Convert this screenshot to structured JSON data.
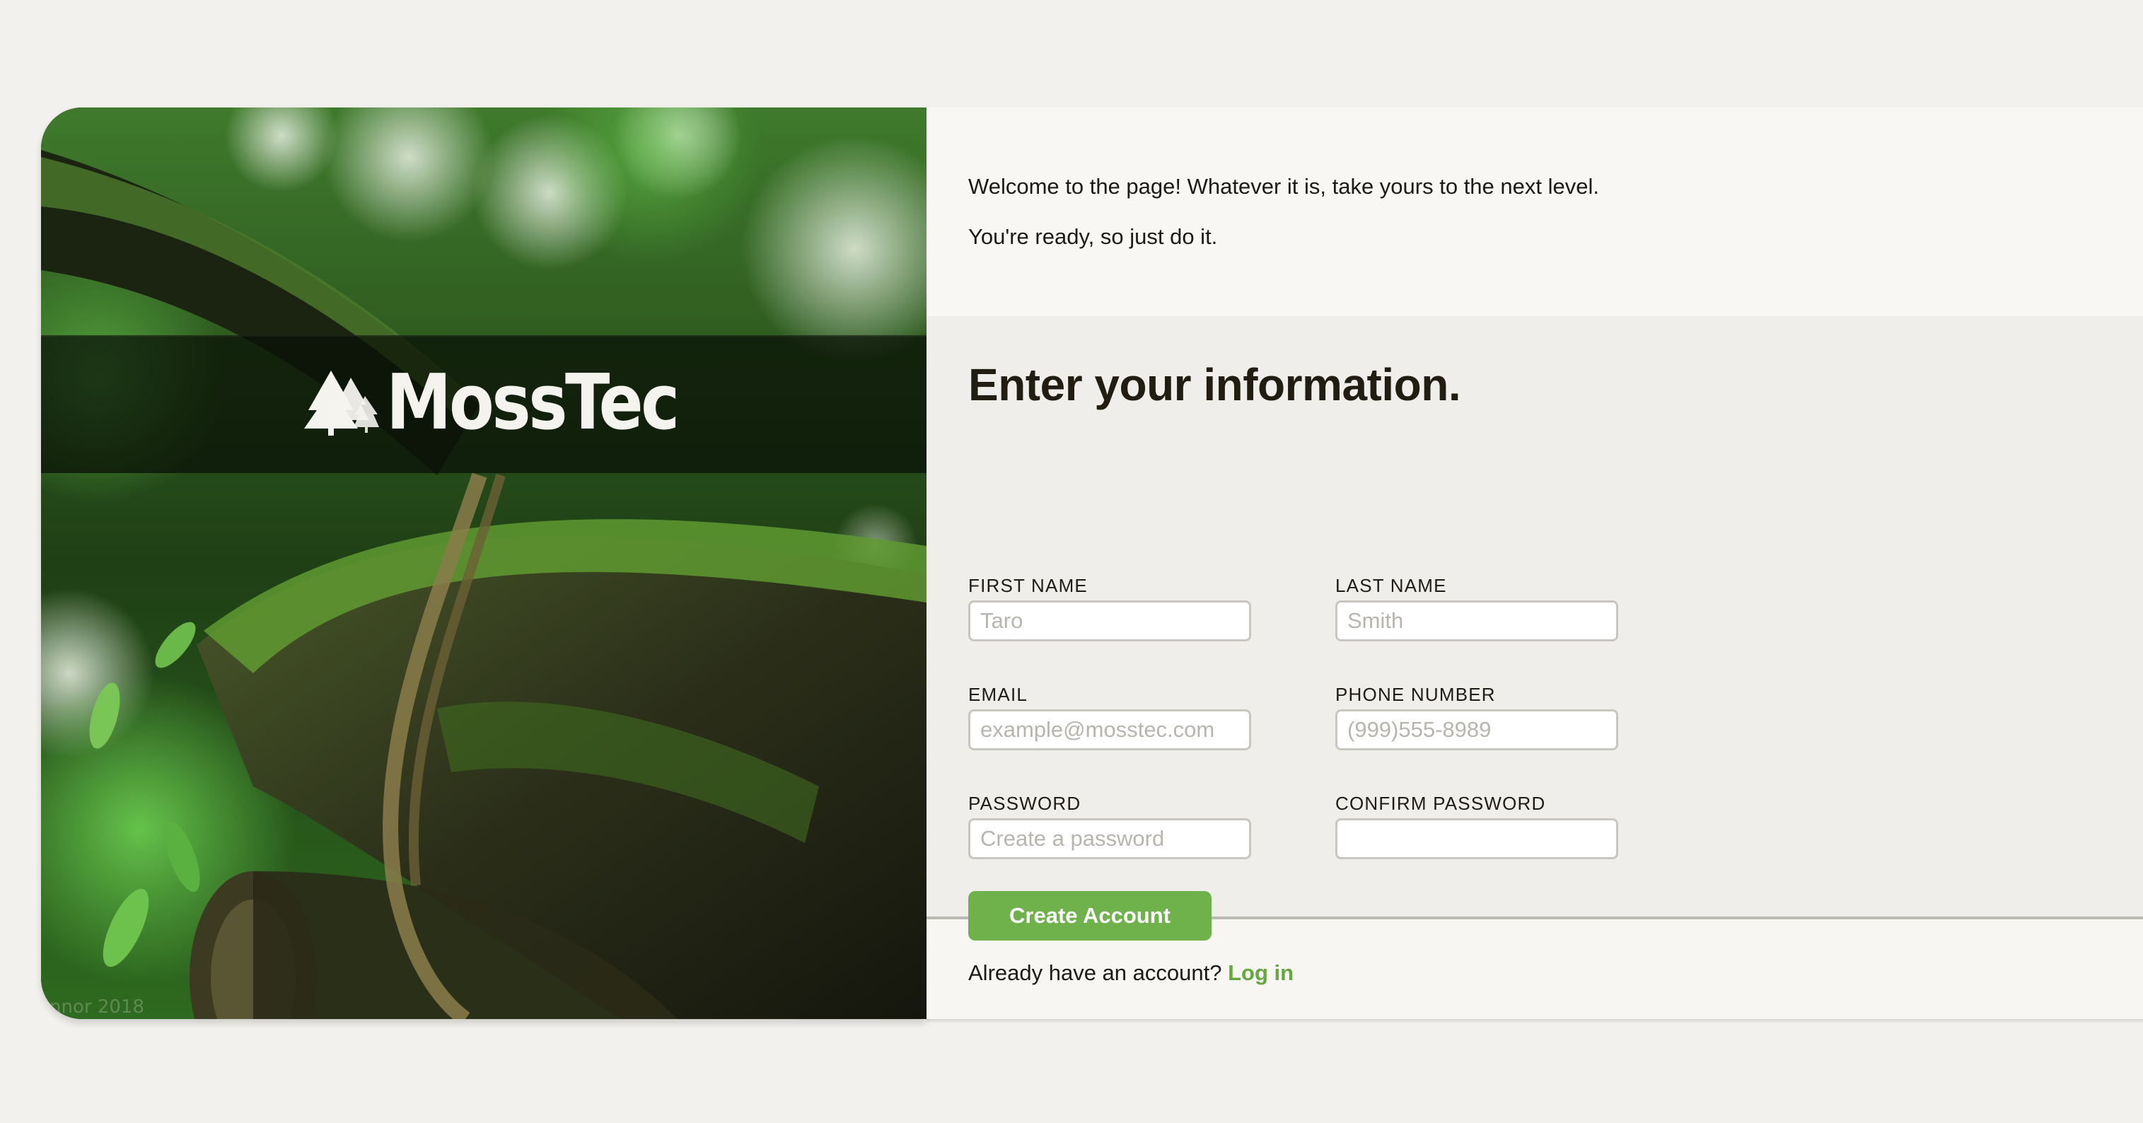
{
  "brand": {
    "name": "MossTec",
    "photo_credit": "nnor 2018"
  },
  "intro": {
    "line1": "Welcome to the page! Whatever it is, take yours to the next level.",
    "line2": "You're ready, so just do it."
  },
  "form": {
    "title": "Enter your information.",
    "fields": {
      "first_name": {
        "label": "FIRST NAME",
        "placeholder": "Taro",
        "value": ""
      },
      "last_name": {
        "label": "LAST NAME",
        "placeholder": "Smith",
        "value": ""
      },
      "email": {
        "label": "EMAIL",
        "placeholder": "example@mosstec.com",
        "value": ""
      },
      "phone": {
        "label": "PHONE NUMBER",
        "placeholder": "(999)555-8989",
        "value": ""
      },
      "password": {
        "label": "PASSWORD",
        "placeholder": "Create a password",
        "value": ""
      },
      "confirm_password": {
        "label": "CONFIRM PASSWORD",
        "placeholder": "",
        "value": ""
      }
    }
  },
  "footer": {
    "create_label": "Create Account",
    "login_prompt": "Already have an account?",
    "login_link": "Log in"
  },
  "colors": {
    "accent": "#6fb14a",
    "link": "#64a83f",
    "page_bg": "#f2f1ed",
    "form_bg": "#f0eeea"
  },
  "icons": {
    "logo_mark": "pine-trees-icon"
  }
}
